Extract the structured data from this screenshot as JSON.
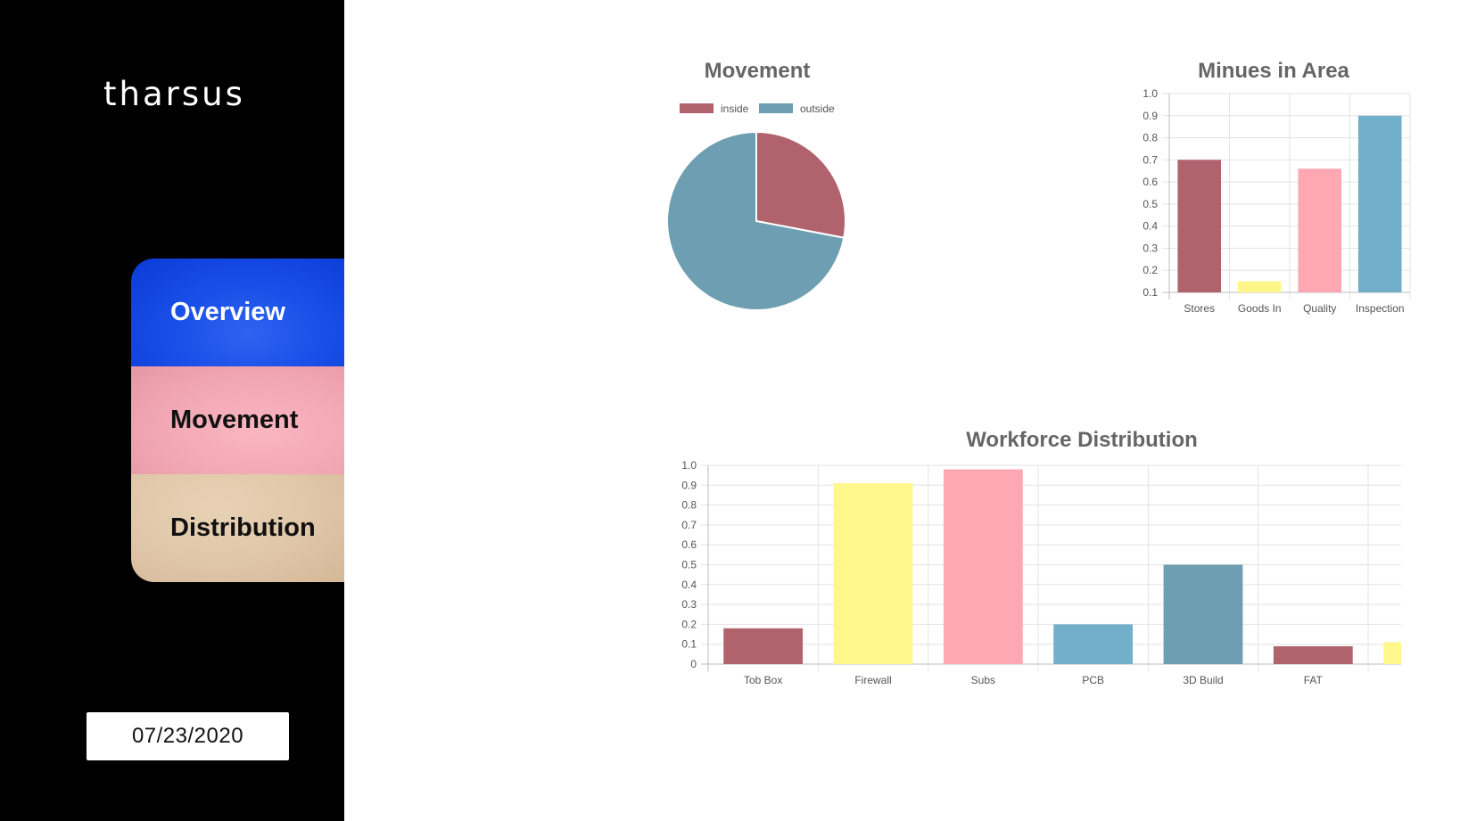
{
  "sidebar": {
    "logo": "tharsus",
    "nav": [
      "Overview",
      "Movement",
      "Distribution"
    ],
    "date": "07/23/2020"
  },
  "chart_data": [
    {
      "type": "pie",
      "title": "Movement",
      "legend_position": "top",
      "labels": [
        "inside",
        "outside"
      ],
      "values": [
        28,
        72
      ],
      "colors": [
        "#b0626d",
        "#6d9eb1"
      ]
    },
    {
      "type": "bar",
      "title": "Minues in Area",
      "categories": [
        "Stores",
        "Goods In",
        "Quality",
        "Inspection"
      ],
      "values": [
        0.7,
        0.15,
        0.66,
        0.9
      ],
      "colors": [
        "#b0626d",
        "#fff78a",
        "#ffa8b4",
        "#72afcb"
      ],
      "ylim": [
        0.1,
        1.0
      ],
      "yticks": [
        "0.1",
        "0.2",
        "0.3",
        "0.4",
        "0.5",
        "0.6",
        "0.7",
        "0.8",
        "0.9",
        "1.0"
      ],
      "grid": true
    },
    {
      "type": "bar",
      "title": "Workforce Distribution",
      "categories": [
        "Tob Box",
        "Firewall",
        "Subs",
        "PCB",
        "3D Build",
        "FAT"
      ],
      "values": [
        0.18,
        0.91,
        0.98,
        0.2,
        0.5,
        0.09
      ],
      "colors": [
        "#b0626d",
        "#fff78a",
        "#ffa8b4",
        "#72afcb",
        "#6d9eb1",
        "#b0626d"
      ],
      "ylim": [
        0,
        1.0
      ],
      "yticks": [
        "0",
        "0.1",
        "0.2",
        "0.3",
        "0.4",
        "0.5",
        "0.6",
        "0.7",
        "0.8",
        "0.9",
        "1.0"
      ],
      "grid": true
    }
  ]
}
